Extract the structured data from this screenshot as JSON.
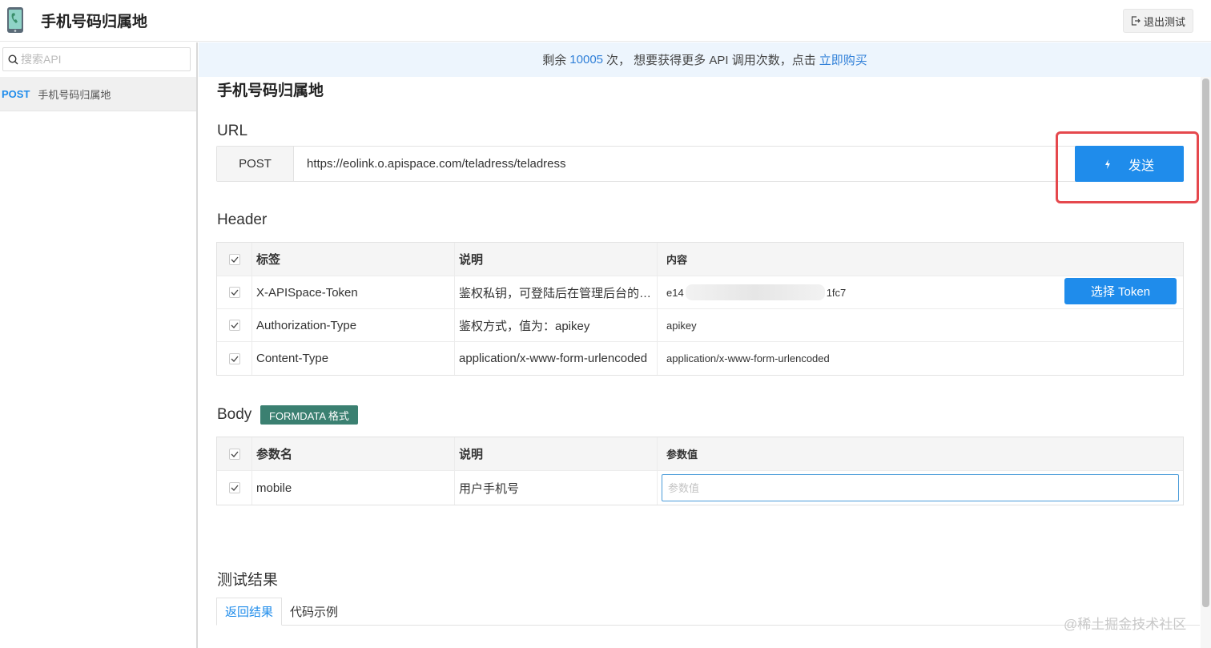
{
  "header": {
    "title": "手机号码归属地",
    "exit_label": "退出测试"
  },
  "sidebar": {
    "search_placeholder": "搜索API",
    "items": [
      {
        "method": "POST",
        "name": "手机号码归属地"
      }
    ]
  },
  "notice": {
    "prefix": "剩余",
    "count": "10005",
    "middle": "次，  想要获得更多 API 调用次数，点击",
    "link": "立即购买"
  },
  "main": {
    "title": "手机号码归属地",
    "url_section": "URL",
    "method": "POST",
    "url": "https://eolink.o.apispace.com/teladress/teladress",
    "send_label": "发送",
    "header_section": "Header",
    "header_columns": [
      "标签",
      "说明",
      "内容"
    ],
    "header_rows": [
      {
        "name": "X-APISpace-Token",
        "desc": "鉴权私钥，可登陆后在管理后台的…",
        "value_start": "e14",
        "value_end": "1fc7",
        "button": "选择 Token"
      },
      {
        "name": "Authorization-Type",
        "desc": "鉴权方式，值为：apikey",
        "value": "apikey"
      },
      {
        "name": "Content-Type",
        "desc": "application/x-www-form-urlencoded",
        "value": "application/x-www-form-urlencoded"
      }
    ],
    "body_section": "Body",
    "body_tag": "FORMDATA 格式",
    "body_columns": [
      "参数名",
      "说明",
      "参数值"
    ],
    "body_rows": [
      {
        "name": "mobile",
        "desc": "用户手机号",
        "placeholder": "参数值",
        "value": ""
      }
    ],
    "result_section": "测试结果",
    "tabs": [
      "返回结果",
      "代码示例"
    ]
  },
  "watermark": "@稀土掘金技术社区",
  "colors": {
    "primary": "#1f8ceb",
    "highlight": "#e5484d",
    "tag": "#3b8071",
    "notice_bg": "#edf5fd"
  }
}
